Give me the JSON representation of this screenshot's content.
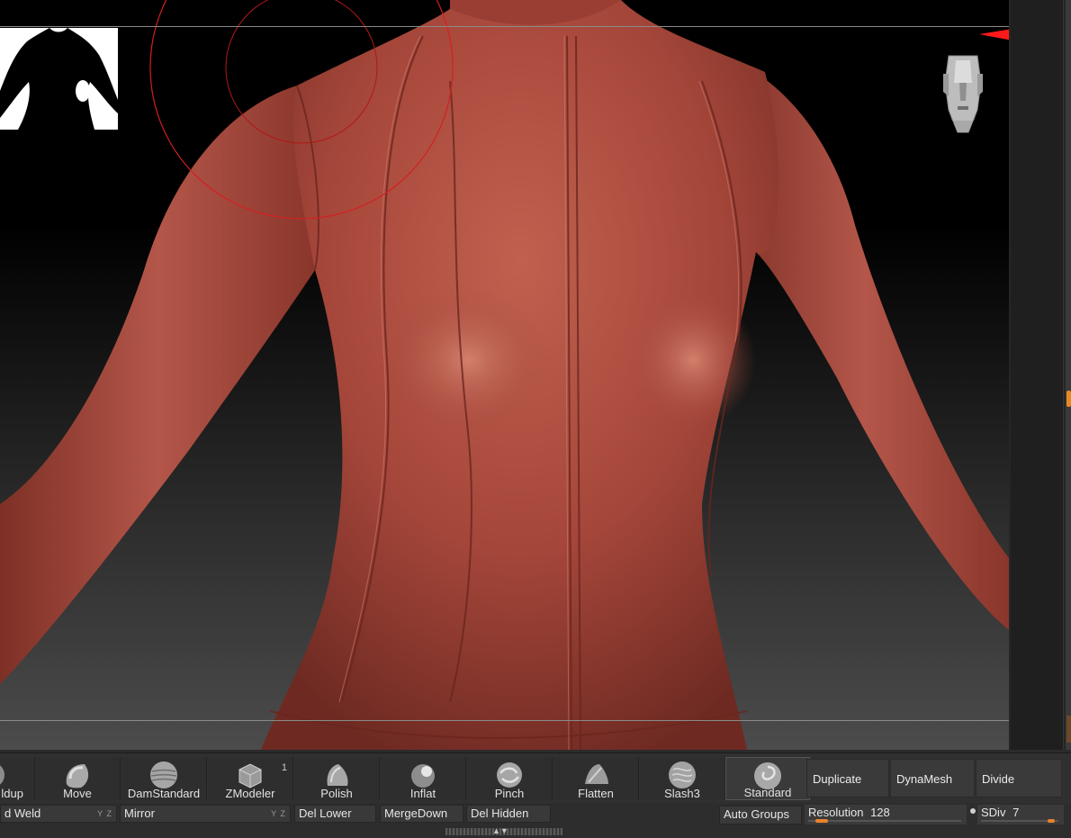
{
  "brush_shelf": {
    "brushes": [
      {
        "label": "ldup",
        "icon": "clay-buildup-brush-icon"
      },
      {
        "label": "Move",
        "icon": "move-brush-icon"
      },
      {
        "label": "DamStandard",
        "icon": "damstandard-brush-icon"
      },
      {
        "label": "ZModeler",
        "icon": "zmodeler-brush-icon",
        "badge": "1"
      },
      {
        "label": "Polish",
        "icon": "polish-brush-icon"
      },
      {
        "label": "Inflat",
        "icon": "inflate-brush-icon"
      },
      {
        "label": "Pinch",
        "icon": "pinch-brush-icon"
      },
      {
        "label": "Flatten",
        "icon": "flatten-brush-icon"
      },
      {
        "label": "Slash3",
        "icon": "slash3-brush-icon"
      },
      {
        "label": "Standard",
        "icon": "standard-brush-icon",
        "selected": true
      }
    ],
    "buttons": {
      "duplicate": "Duplicate",
      "dynamesh": "DynaMesh",
      "divide": "Divide"
    }
  },
  "bottom_row": {
    "weld": "d Weld",
    "mirror": "Mirror",
    "del_lower": "Del Lower",
    "merge_down": "MergeDown",
    "del_hidden": "Del Hidden",
    "auto_groups": "Auto Groups",
    "resolution": {
      "label": "Resolution",
      "value": "128",
      "fraction": 0.05
    },
    "sdiv": {
      "label": "SDiv",
      "value": "7",
      "fraction": 0.95
    },
    "axis_hint": "Y Z"
  },
  "colors": {
    "viewport_bg_top": "#000000",
    "viewport_bg_bottom": "#4c4c4c",
    "clay": "#a8473a",
    "accent": "#e8832a",
    "brush_circle": "#d42020",
    "gizmo_x": "#ff1a1a",
    "gizmo_y": "#22dd22",
    "gizmo_z": "#1a1aff"
  }
}
